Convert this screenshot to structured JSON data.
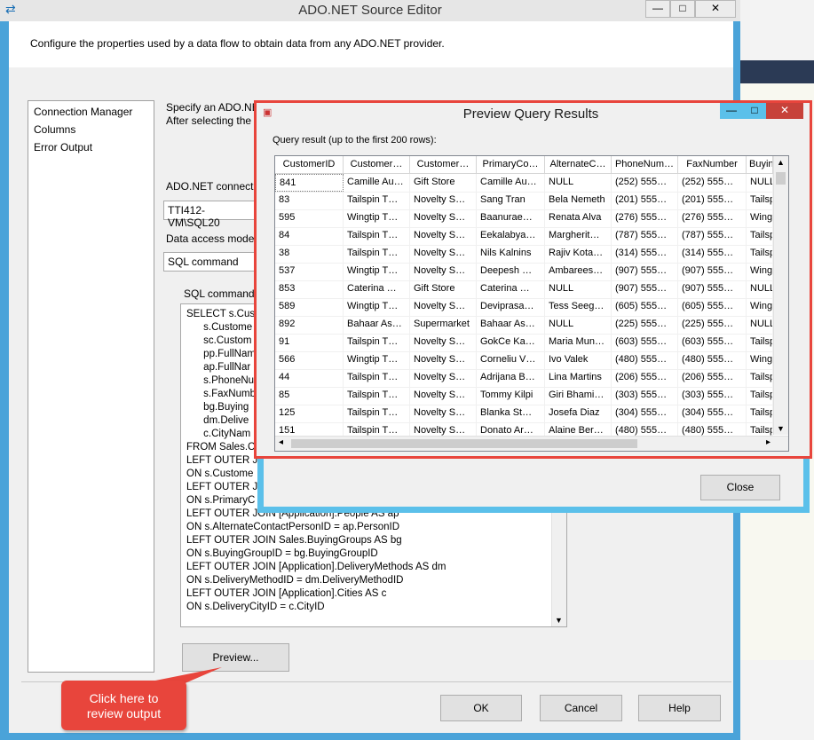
{
  "editor": {
    "title": "ADO.NET Source Editor",
    "description": "Configure the properties used by a data flow to obtain data from any ADO.NET provider.",
    "nav": [
      "Connection Manager",
      "Columns",
      "Error Output"
    ],
    "spec_line1": "Specify an ADO.NE",
    "spec_line2": "After selecting the",
    "conn_label": "ADO.NET connecti",
    "conn_value": "TTI412-VM\\SQL20",
    "access_label": "Data access mode:",
    "access_value": "SQL command",
    "sql_label": "SQL command",
    "sql_lines": [
      "SELECT s.Cust",
      "      s.Custome",
      "      sc.Custom",
      "      pp.FullNam",
      "      ap.FullNar",
      "      s.PhoneNu",
      "      s.FaxNumb",
      "      bg.Buying",
      "      dm.Delive",
      "      c.CityNam",
      "FROM Sales.Cu",
      "LEFT OUTER JO",
      "ON s.Custome",
      "LEFT OUTER JO",
      "ON s.PrimaryC",
      "LEFT OUTER JOIN [Application].People AS ap",
      "ON s.AlternateContactPersonID = ap.PersonID",
      "LEFT OUTER JOIN Sales.BuyingGroups AS bg",
      "ON s.BuyingGroupID = bg.BuyingGroupID",
      "LEFT OUTER JOIN [Application].DeliveryMethods AS dm",
      "ON s.DeliveryMethodID = dm.DeliveryMethodID",
      "LEFT OUTER JOIN [Application].Cities AS c",
      "ON s.DeliveryCityID = c.CityID"
    ],
    "preview_btn": "Preview...",
    "ok_btn": "OK",
    "cancel_btn": "Cancel",
    "help_btn": "Help"
  },
  "callout": {
    "line1": "Click here to",
    "line2": "review output"
  },
  "preview": {
    "title": "Preview Query Results",
    "result_label": "Query result (up to the first 200 rows):",
    "close_btn": "Close",
    "columns": [
      "CustomerID",
      "Customer…",
      "Customer…",
      "PrimaryCo…",
      "AlternateC…",
      "PhoneNum…",
      "FaxNumber",
      "Buyin"
    ],
    "rows": [
      [
        "841",
        "Camille Au…",
        "Gift Store",
        "Camille Au…",
        "NULL",
        "(252) 555…",
        "(252) 555…",
        "NULL"
      ],
      [
        "83",
        "Tailspin T…",
        "Novelty S…",
        "Sang Tran",
        "Bela Nemeth",
        "(201) 555…",
        "(201) 555…",
        "Tailsp"
      ],
      [
        "595",
        "Wingtip T…",
        "Novelty S…",
        "Baanurae…",
        "Renata Alva",
        "(276) 555…",
        "(276) 555…",
        "Wing"
      ],
      [
        "84",
        "Tailspin T…",
        "Novelty S…",
        "Eekalabya…",
        "Margherit…",
        "(787) 555…",
        "(787) 555…",
        "Tailsp"
      ],
      [
        "38",
        "Tailspin T…",
        "Novelty S…",
        "Nils Kalnins",
        "Rajiv Kota…",
        "(314) 555…",
        "(314) 555…",
        "Tailsp"
      ],
      [
        "537",
        "Wingtip T…",
        "Novelty S…",
        "Deepesh …",
        "Ambarees…",
        "(907) 555…",
        "(907) 555…",
        "Wing"
      ],
      [
        "853",
        "Caterina …",
        "Gift Store",
        "Caterina …",
        "NULL",
        "(907) 555…",
        "(907) 555…",
        "NULL"
      ],
      [
        "589",
        "Wingtip T…",
        "Novelty S…",
        "Deviprasa…",
        "Tess Seeg…",
        "(605) 555…",
        "(605) 555…",
        "Wing"
      ],
      [
        "892",
        "Bahaar As…",
        "Supermarket",
        "Bahaar As…",
        "NULL",
        "(225) 555…",
        "(225) 555…",
        "NULL"
      ],
      [
        "91",
        "Tailspin T…",
        "Novelty S…",
        "GokCe Ka…",
        "Maria Mun…",
        "(603) 555…",
        "(603) 555…",
        "Tailsp"
      ],
      [
        "566",
        "Wingtip T…",
        "Novelty S…",
        "Corneliu V…",
        "Ivo Valek",
        "(480) 555…",
        "(480) 555…",
        "Wing"
      ],
      [
        "44",
        "Tailspin T…",
        "Novelty S…",
        "Adrijana B…",
        "Lina Martins",
        "(206) 555…",
        "(206) 555…",
        "Tailsp"
      ],
      [
        "85",
        "Tailspin T…",
        "Novelty S…",
        "Tommy Kilpi",
        "Giri Bhami…",
        "(303) 555…",
        "(303) 555…",
        "Tailsp"
      ],
      [
        "125",
        "Tailspin T…",
        "Novelty S…",
        "Blanka St…",
        "Josefa Diaz",
        "(304) 555…",
        "(304) 555…",
        "Tailsp"
      ],
      [
        "151",
        "Tailspin T…",
        "Novelty S…",
        "Donato Ar…",
        "Alaine Ber…",
        "(480) 555…",
        "(480) 555…",
        "Tailsp"
      ]
    ]
  },
  "colors": {
    "accent": "#5bc0ea",
    "highlight": "#e8453c",
    "titlebar": "#e6e6e6"
  }
}
